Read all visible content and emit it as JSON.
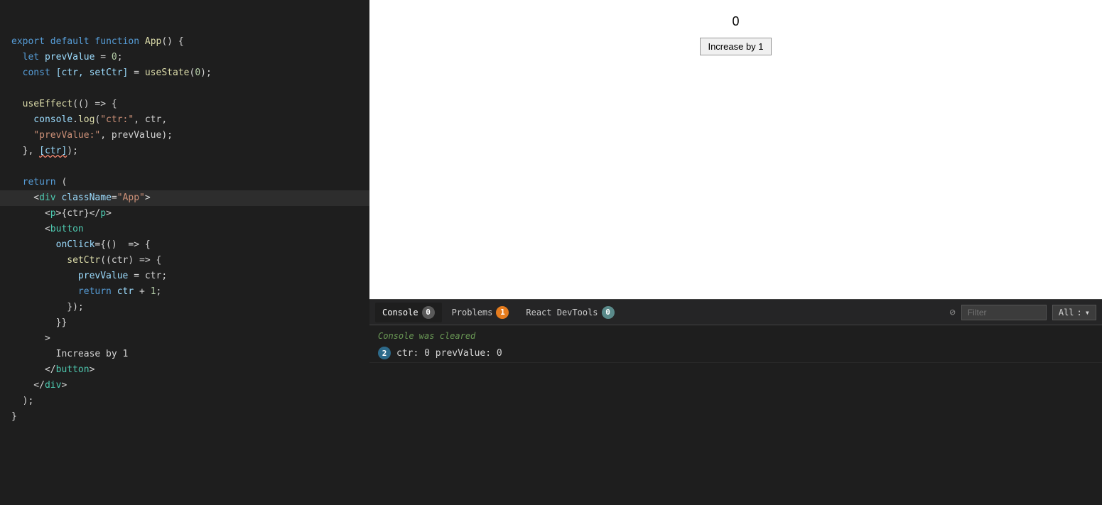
{
  "editor": {
    "lines": [
      {
        "id": 1,
        "tokens": [
          {
            "text": "export ",
            "cls": "kw"
          },
          {
            "text": "default ",
            "cls": "kw"
          },
          {
            "text": "function ",
            "cls": "kw"
          },
          {
            "text": "App",
            "cls": "fn"
          },
          {
            "text": "() {",
            "cls": "plain"
          }
        ],
        "highlighted": false
      },
      {
        "id": 2,
        "tokens": [
          {
            "text": "  let ",
            "cls": "kw"
          },
          {
            "text": "prevValue",
            "cls": "var"
          },
          {
            "text": " = ",
            "cls": "op"
          },
          {
            "text": "0",
            "cls": "num"
          },
          {
            "text": ";",
            "cls": "plain"
          }
        ],
        "highlighted": false
      },
      {
        "id": 3,
        "tokens": [
          {
            "text": "  const ",
            "cls": "kw"
          },
          {
            "text": "[ctr, setCtr]",
            "cls": "var"
          },
          {
            "text": " = ",
            "cls": "op"
          },
          {
            "text": "useState",
            "cls": "fn"
          },
          {
            "text": "(",
            "cls": "plain"
          },
          {
            "text": "0",
            "cls": "num"
          },
          {
            "text": ");",
            "cls": "plain"
          }
        ],
        "highlighted": false
      },
      {
        "id": 4,
        "tokens": [],
        "highlighted": false
      },
      {
        "id": 5,
        "tokens": [
          {
            "text": "  useEffect",
            "cls": "fn"
          },
          {
            "text": "(() => {",
            "cls": "plain"
          }
        ],
        "highlighted": false
      },
      {
        "id": 6,
        "tokens": [
          {
            "text": "    console",
            "cls": "var"
          },
          {
            "text": ".",
            "cls": "plain"
          },
          {
            "text": "log",
            "cls": "method"
          },
          {
            "text": "(",
            "cls": "plain"
          },
          {
            "text": "\"ctr:\"",
            "cls": "str"
          },
          {
            "text": ", ctr,",
            "cls": "plain"
          }
        ],
        "highlighted": false
      },
      {
        "id": 7,
        "tokens": [
          {
            "text": "    \"prevValue:\"",
            "cls": "str"
          },
          {
            "text": ", prevValue);",
            "cls": "plain"
          }
        ],
        "highlighted": false
      },
      {
        "id": 8,
        "tokens": [
          {
            "text": "  }, ",
            "cls": "plain"
          },
          {
            "text": "[ctr]",
            "cls": "var",
            "underline": true
          },
          {
            "text": ");",
            "cls": "plain"
          }
        ],
        "highlighted": false
      },
      {
        "id": 9,
        "tokens": [],
        "highlighted": false
      },
      {
        "id": 10,
        "tokens": [
          {
            "text": "  return ",
            "cls": "kw"
          },
          {
            "text": "(",
            "cls": "plain"
          }
        ],
        "highlighted": false
      },
      {
        "id": 11,
        "tokens": [
          {
            "text": "    <",
            "cls": "plain"
          },
          {
            "text": "div",
            "cls": "jsx-tag"
          },
          {
            "text": " className",
            "cls": "jsx-attr"
          },
          {
            "text": "=",
            "cls": "plain"
          },
          {
            "text": "\"App\"",
            "cls": "jsx-str"
          },
          {
            "text": ">",
            "cls": "plain"
          }
        ],
        "highlighted": true
      },
      {
        "id": 12,
        "tokens": [
          {
            "text": "      <",
            "cls": "plain"
          },
          {
            "text": "p",
            "cls": "jsx-tag"
          },
          {
            "text": ">{ctr}</",
            "cls": "plain"
          },
          {
            "text": "p",
            "cls": "jsx-tag"
          },
          {
            "text": ">",
            "cls": "plain"
          }
        ],
        "highlighted": false
      },
      {
        "id": 13,
        "tokens": [
          {
            "text": "      <",
            "cls": "plain"
          },
          {
            "text": "button",
            "cls": "jsx-tag"
          }
        ],
        "highlighted": false
      },
      {
        "id": 14,
        "tokens": [
          {
            "text": "        onClick",
            "cls": "jsx-attr"
          },
          {
            "text": "={()  => {",
            "cls": "plain"
          }
        ],
        "highlighted": false
      },
      {
        "id": 15,
        "tokens": [
          {
            "text": "          setCtr",
            "cls": "fn"
          },
          {
            "text": "((ctr) => {",
            "cls": "plain"
          }
        ],
        "highlighted": false
      },
      {
        "id": 16,
        "tokens": [
          {
            "text": "            prevValue",
            "cls": "var"
          },
          {
            "text": " = ctr;",
            "cls": "plain"
          }
        ],
        "highlighted": false
      },
      {
        "id": 17,
        "tokens": [
          {
            "text": "            return ",
            "cls": "kw"
          },
          {
            "text": "ctr",
            "cls": "var"
          },
          {
            "text": " + ",
            "cls": "op"
          },
          {
            "text": "1",
            "cls": "num"
          },
          {
            "text": ";",
            "cls": "plain"
          }
        ],
        "highlighted": false
      },
      {
        "id": 18,
        "tokens": [
          {
            "text": "          });",
            "cls": "plain"
          }
        ],
        "highlighted": false
      },
      {
        "id": 19,
        "tokens": [
          {
            "text": "        }}",
            "cls": "plain"
          }
        ],
        "highlighted": false
      },
      {
        "id": 20,
        "tokens": [
          {
            "text": "      >",
            "cls": "plain"
          }
        ],
        "highlighted": false
      },
      {
        "id": 21,
        "tokens": [
          {
            "text": "        Increase by 1",
            "cls": "plain"
          }
        ],
        "highlighted": false
      },
      {
        "id": 22,
        "tokens": [
          {
            "text": "      </",
            "cls": "plain"
          },
          {
            "text": "button",
            "cls": "jsx-tag"
          },
          {
            "text": ">",
            "cls": "plain"
          }
        ],
        "highlighted": false
      },
      {
        "id": 23,
        "tokens": [
          {
            "text": "    </",
            "cls": "plain"
          },
          {
            "text": "div",
            "cls": "jsx-tag"
          },
          {
            "text": ">",
            "cls": "plain"
          }
        ],
        "highlighted": false
      },
      {
        "id": 24,
        "tokens": [
          {
            "text": "  );",
            "cls": "plain"
          }
        ],
        "highlighted": false
      },
      {
        "id": 25,
        "tokens": [
          {
            "text": "}",
            "cls": "plain"
          }
        ],
        "highlighted": false
      }
    ]
  },
  "preview": {
    "counter_value": "0",
    "button_label": "Increase by 1"
  },
  "console": {
    "tabs": [
      {
        "id": "console",
        "label": "Console",
        "badge": "0",
        "badge_type": "gray",
        "active": true
      },
      {
        "id": "problems",
        "label": "Problems",
        "badge": "1",
        "badge_type": "orange",
        "active": false
      },
      {
        "id": "devtools",
        "label": "React DevTools",
        "badge": "0",
        "badge_type": "teal",
        "active": false
      }
    ],
    "filter_placeholder": "Filter",
    "filter_dropdown_label": "All",
    "cleared_message": "Console was cleared",
    "log_entry": {
      "count": "2",
      "text": "ctr: 0 prevValue: 0"
    }
  }
}
